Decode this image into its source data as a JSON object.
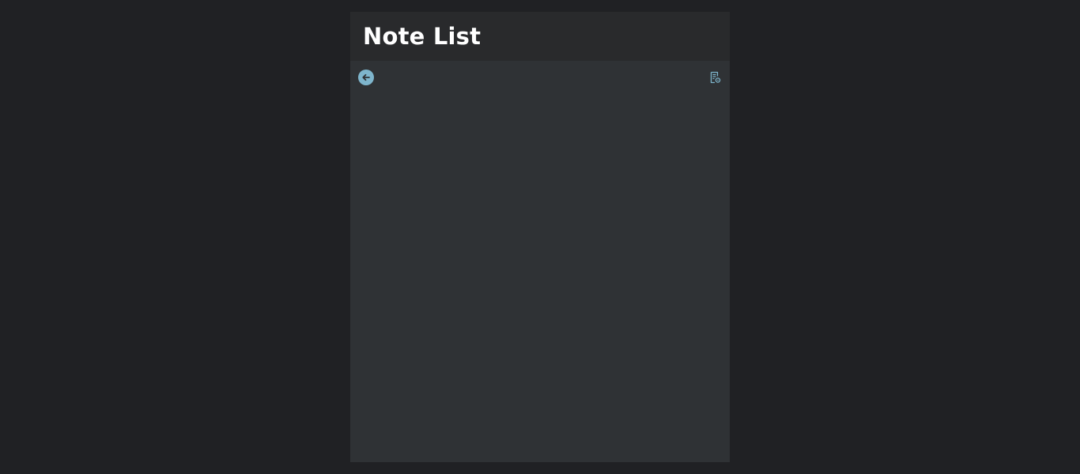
{
  "header": {
    "title": "Note List"
  },
  "toolbar": {
    "back_icon": "arrow-left-circle-icon",
    "notes_icon": "note-settings-icon"
  },
  "notes": [],
  "colors": {
    "page_background": "#202124",
    "panel_background": "#2f3235",
    "header_background": "#292a2c",
    "title_text": "#ffffff",
    "accent": "#7eb5cc"
  }
}
